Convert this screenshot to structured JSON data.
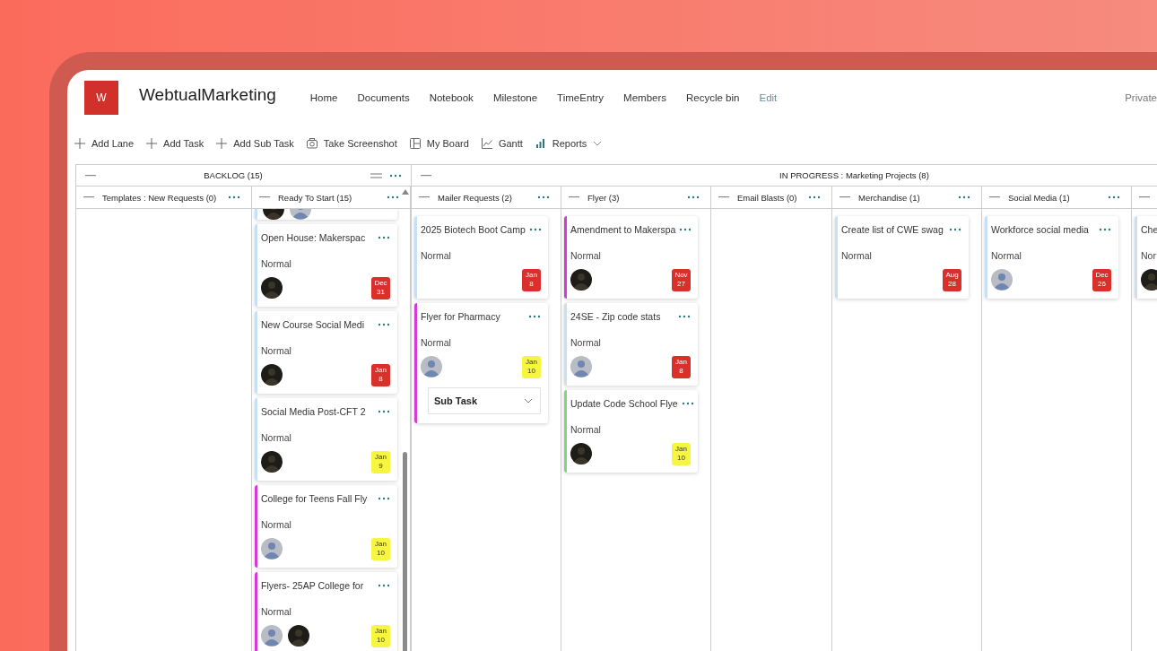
{
  "site": {
    "logo_letter": "W",
    "title": "WebtualMarketing",
    "privacy": "Private"
  },
  "nav": [
    {
      "label": "Home",
      "kind": "page"
    },
    {
      "label": "Documents",
      "kind": "page"
    },
    {
      "label": "Notebook",
      "kind": "page"
    },
    {
      "label": "Milestone",
      "kind": "page"
    },
    {
      "label": "TimeEntry",
      "kind": "page"
    },
    {
      "label": "Members",
      "kind": "page"
    },
    {
      "label": "Recycle bin",
      "kind": "page"
    },
    {
      "label": "Edit",
      "kind": "action"
    }
  ],
  "toolbar": [
    {
      "label": "Add Lane",
      "dropdown": false
    },
    {
      "label": "Add Task",
      "dropdown": false
    },
    {
      "label": "Add Sub Task",
      "dropdown": false
    },
    {
      "label": "Take Screenshot",
      "dropdown": false
    },
    {
      "label": "My Board",
      "dropdown": false
    },
    {
      "label": "Gantt",
      "dropdown": false
    },
    {
      "label": "Reports",
      "dropdown": true
    }
  ],
  "groups": [
    {
      "title": "BACKLOG (15)",
      "lanes": [
        {
          "title": "Templates : New Requests (0)"
        },
        {
          "title": "Ready To Start (15)",
          "cards": [
            {
              "kind": "partial",
              "color": "#c7e0f4",
              "avatars": [
                {
                  "kind": "dark"
                },
                {
                  "kind": "light"
                }
              ]
            },
            {
              "kind": "task",
              "title": "Open House: Makerspac",
              "priority": "Normal",
              "color": "#c7e0f4",
              "avatars": [
                {
                  "kind": "dark"
                }
              ],
              "due": {
                "month": "Dec",
                "day": "31",
                "overdue": true
              }
            },
            {
              "kind": "task",
              "title": "New Course Social Medi",
              "priority": "Normal",
              "color": "#c7e0f4",
              "avatars": [
                {
                  "kind": "dark"
                }
              ],
              "due": {
                "month": "Jan",
                "day": "8",
                "overdue": true
              }
            },
            {
              "kind": "task",
              "title": "Social Media Post-CFT 2",
              "priority": "Normal",
              "color": "#c7e0f4",
              "avatars": [
                {
                  "kind": "dark"
                }
              ],
              "due": {
                "month": "Jan",
                "day": "9",
                "overdue": false
              }
            },
            {
              "kind": "task",
              "title": "College for Teens Fall Fly",
              "priority": "Normal",
              "color": "#d63ad6",
              "avatars": [
                {
                  "kind": "light"
                }
              ],
              "due": {
                "month": "Jan",
                "day": "10",
                "overdue": false
              }
            },
            {
              "kind": "task",
              "title": "Flyers- 25AP College for",
              "priority": "Normal",
              "color": "#d63ad6",
              "avatars": [
                {
                  "kind": "light"
                },
                {
                  "kind": "dark"
                }
              ],
              "due": {
                "month": "Jan",
                "day": "10",
                "overdue": false
              }
            }
          ]
        }
      ]
    },
    {
      "title": "IN PROGRESS : Marketing Projects (8)",
      "lanes": [
        {
          "title": "Mailer Requests (2)",
          "cards": [
            {
              "kind": "task",
              "title": "2025 Biotech Boot Camp",
              "priority": "Normal",
              "color": "#c7e0f4",
              "due": {
                "month": "Jan",
                "day": "8",
                "overdue": true
              }
            },
            {
              "kind": "task",
              "title": "Flyer for Pharmacy",
              "priority": "Normal",
              "color": "#d63ad6",
              "avatars": [
                {
                  "kind": "light"
                }
              ],
              "due": {
                "month": "Jan",
                "day": "10",
                "overdue": false
              },
              "subtask": "Sub Task"
            }
          ]
        },
        {
          "title": "Flyer (3)",
          "cards": [
            {
              "kind": "task",
              "title": "Amendment to Makerspa",
              "priority": "Normal",
              "color": "#d63ad6",
              "avatars": [
                {
                  "kind": "dark"
                }
              ],
              "due": {
                "month": "Nov",
                "day": "27",
                "overdue": true
              }
            },
            {
              "kind": "task",
              "title": "24SE - Zip code stats",
              "priority": "Normal",
              "color": "#c7e0f4",
              "avatars": [
                {
                  "kind": "light"
                }
              ],
              "due": {
                "month": "Jan",
                "day": "8",
                "overdue": true
              }
            },
            {
              "kind": "task",
              "title": "Update Code School Flye",
              "priority": "Normal",
              "color": "#7ed67e",
              "avatars": [
                {
                  "kind": "dark"
                }
              ],
              "due": {
                "month": "Jan",
                "day": "10",
                "overdue": false
              }
            }
          ]
        },
        {
          "title": "Email Blasts (0)"
        },
        {
          "title": "Merchandise (1)",
          "cards": [
            {
              "kind": "task",
              "title": "Create list of CWE swag",
              "priority": "Normal",
              "color": "#c7e0f4",
              "due": {
                "month": "Aug",
                "day": "28",
                "overdue": true
              }
            }
          ]
        },
        {
          "title": "Social Media (1)",
          "cards": [
            {
              "kind": "task",
              "title": "Workforce social media",
              "priority": "Normal",
              "color": "#c7e0f4",
              "avatars": [
                {
                  "kind": "light"
                }
              ],
              "due": {
                "month": "Dec",
                "day": "26",
                "overdue": true
              }
            }
          ]
        },
        {
          "cards": [
            {
              "kind": "clipped",
              "title": "Che",
              "priority": "Nor",
              "color": "#c7e0f4",
              "avatars": [
                {
                  "kind": "dark"
                }
              ]
            }
          ]
        }
      ]
    }
  ]
}
